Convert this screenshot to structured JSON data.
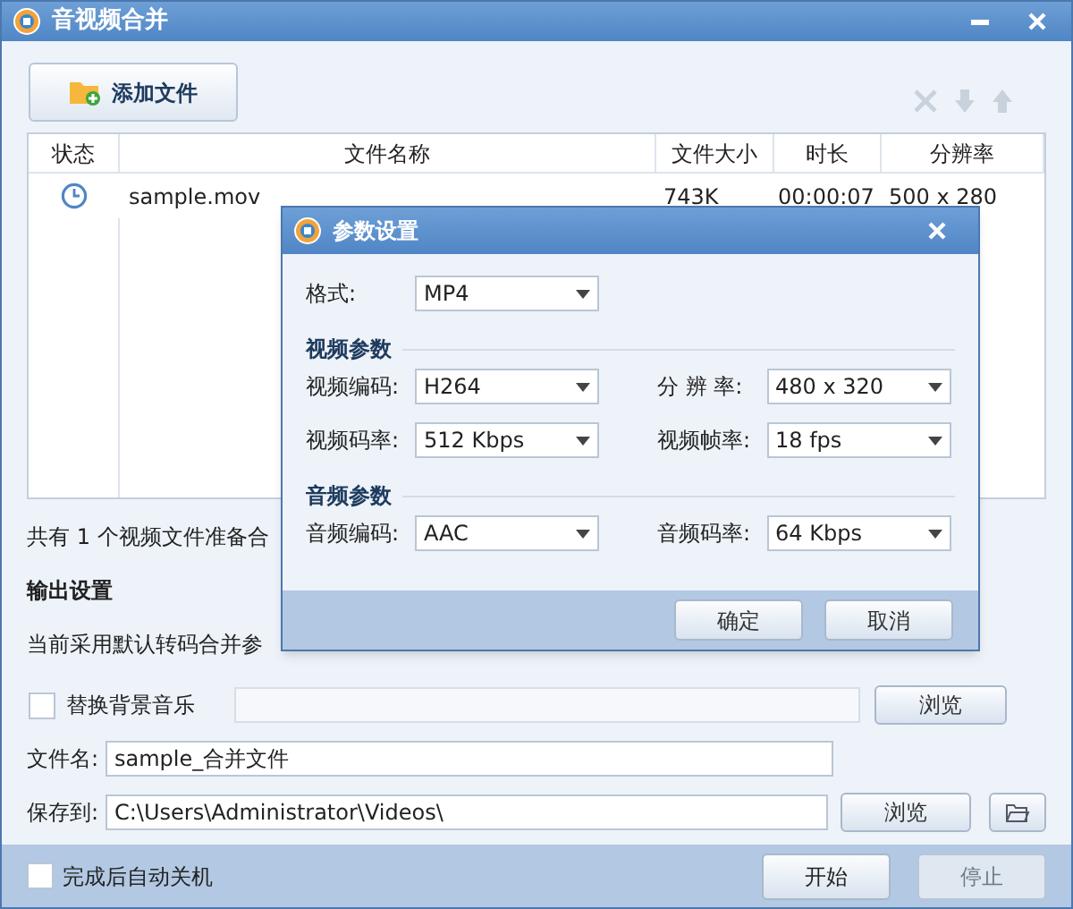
{
  "window": {
    "title": "音视频合并"
  },
  "toolbar": {
    "add_button": "添加文件"
  },
  "table": {
    "columns": [
      "状态",
      "文件名称",
      "文件大小",
      "时长",
      "分辨率"
    ],
    "rows": [
      {
        "name": "sample.mov",
        "size": "743K",
        "duration": "00:00:07",
        "resolution": "500 x 280"
      }
    ]
  },
  "summary": "共有 1 个视频文件准备合",
  "output": {
    "heading": "输出设置",
    "note": "当前采用默认转码合并参",
    "bg_music": {
      "label": "替换背景音乐",
      "checked": false,
      "browse": "浏览"
    },
    "filename": {
      "label": "文件名:",
      "value": "sample_合并文件"
    },
    "save_to": {
      "label": "保存到:",
      "value": "C:\\Users\\Administrator\\Videos\\",
      "browse": "浏览"
    }
  },
  "footer": {
    "shutdown": {
      "label": "完成后自动关机",
      "checked": false
    },
    "buttons": [
      {
        "label": "开始",
        "disabled": false
      },
      {
        "label": "停止",
        "disabled": true
      }
    ]
  },
  "dialog": {
    "title": "参数设置",
    "format": {
      "label": "格式:",
      "value": "MP4"
    },
    "sections": [
      {
        "title": "视频参数",
        "fields": [
          {
            "label": "视频编码:",
            "value": "H264"
          },
          {
            "label": "分 辨 率:",
            "value": "480 x 320"
          },
          {
            "label": "视频码率:",
            "value": "512 Kbps"
          },
          {
            "label": "视频帧率:",
            "value": "18 fps"
          }
        ]
      },
      {
        "title": "音频参数",
        "fields": [
          {
            "label": "音频编码:",
            "value": "AAC"
          },
          {
            "label": "音频码率:",
            "value": "64 Kbps"
          }
        ]
      }
    ],
    "buttons": [
      "确定",
      "取消"
    ]
  }
}
